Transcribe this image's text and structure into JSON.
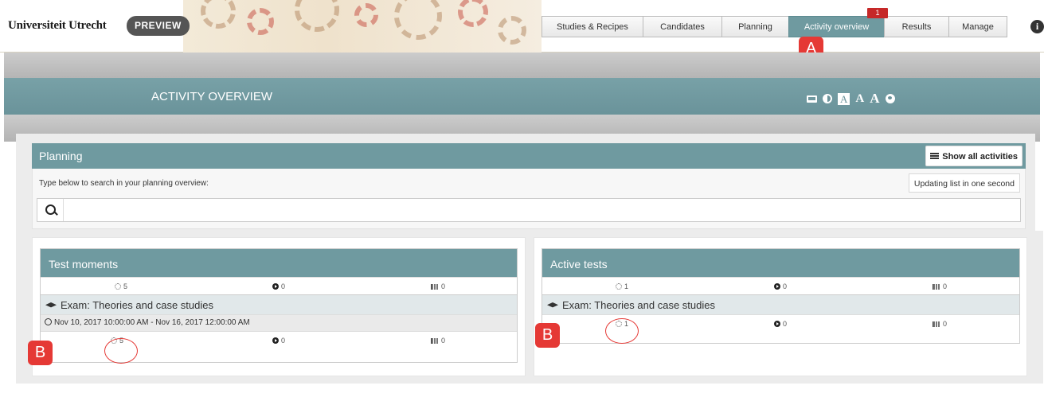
{
  "header": {
    "logo_text": "Universiteit Utrecht",
    "preview_label": "PREVIEW",
    "nav_tabs": [
      {
        "label": "Studies & Recipes"
      },
      {
        "label": "Candidates"
      },
      {
        "label": "Planning"
      },
      {
        "label": "Activity overview"
      },
      {
        "label": "Results"
      },
      {
        "label": "Manage"
      }
    ],
    "active_tab": "Activity overview",
    "notification_count": "1",
    "info_glyph": "i"
  },
  "annotations": {
    "a": "A",
    "b": "B"
  },
  "page": {
    "title": "ACTIVITY OVERVIEW",
    "accessibility": {
      "text_small": "A",
      "text_medium": "A",
      "text_large": "A"
    }
  },
  "planning": {
    "title": "Planning",
    "show_all_label": "Show all activities",
    "search_hint": "Type below to search in your planning overview:",
    "updating_label": "Updating list in one second",
    "search_value": ""
  },
  "test_moments": {
    "title": "Test moments",
    "summary": {
      "pending": "5",
      "active": "0",
      "finished": "0"
    },
    "items": [
      {
        "name": "Exam: Theories and case studies",
        "date_range": "Nov 10, 2017 10:00:00 AM - Nov 16, 2017 12:00:00 AM",
        "pending": "5",
        "active": "0",
        "finished": "0"
      }
    ]
  },
  "active_tests": {
    "title": "Active tests",
    "summary": {
      "pending": "1",
      "active": "0",
      "finished": "0"
    },
    "items": [
      {
        "name": "Exam: Theories and case studies",
        "pending": "1",
        "active": "0",
        "finished": "0"
      }
    ]
  },
  "colors": {
    "accent": "#6f9aa0",
    "marker": "#e53935",
    "badge": "#c62828"
  }
}
